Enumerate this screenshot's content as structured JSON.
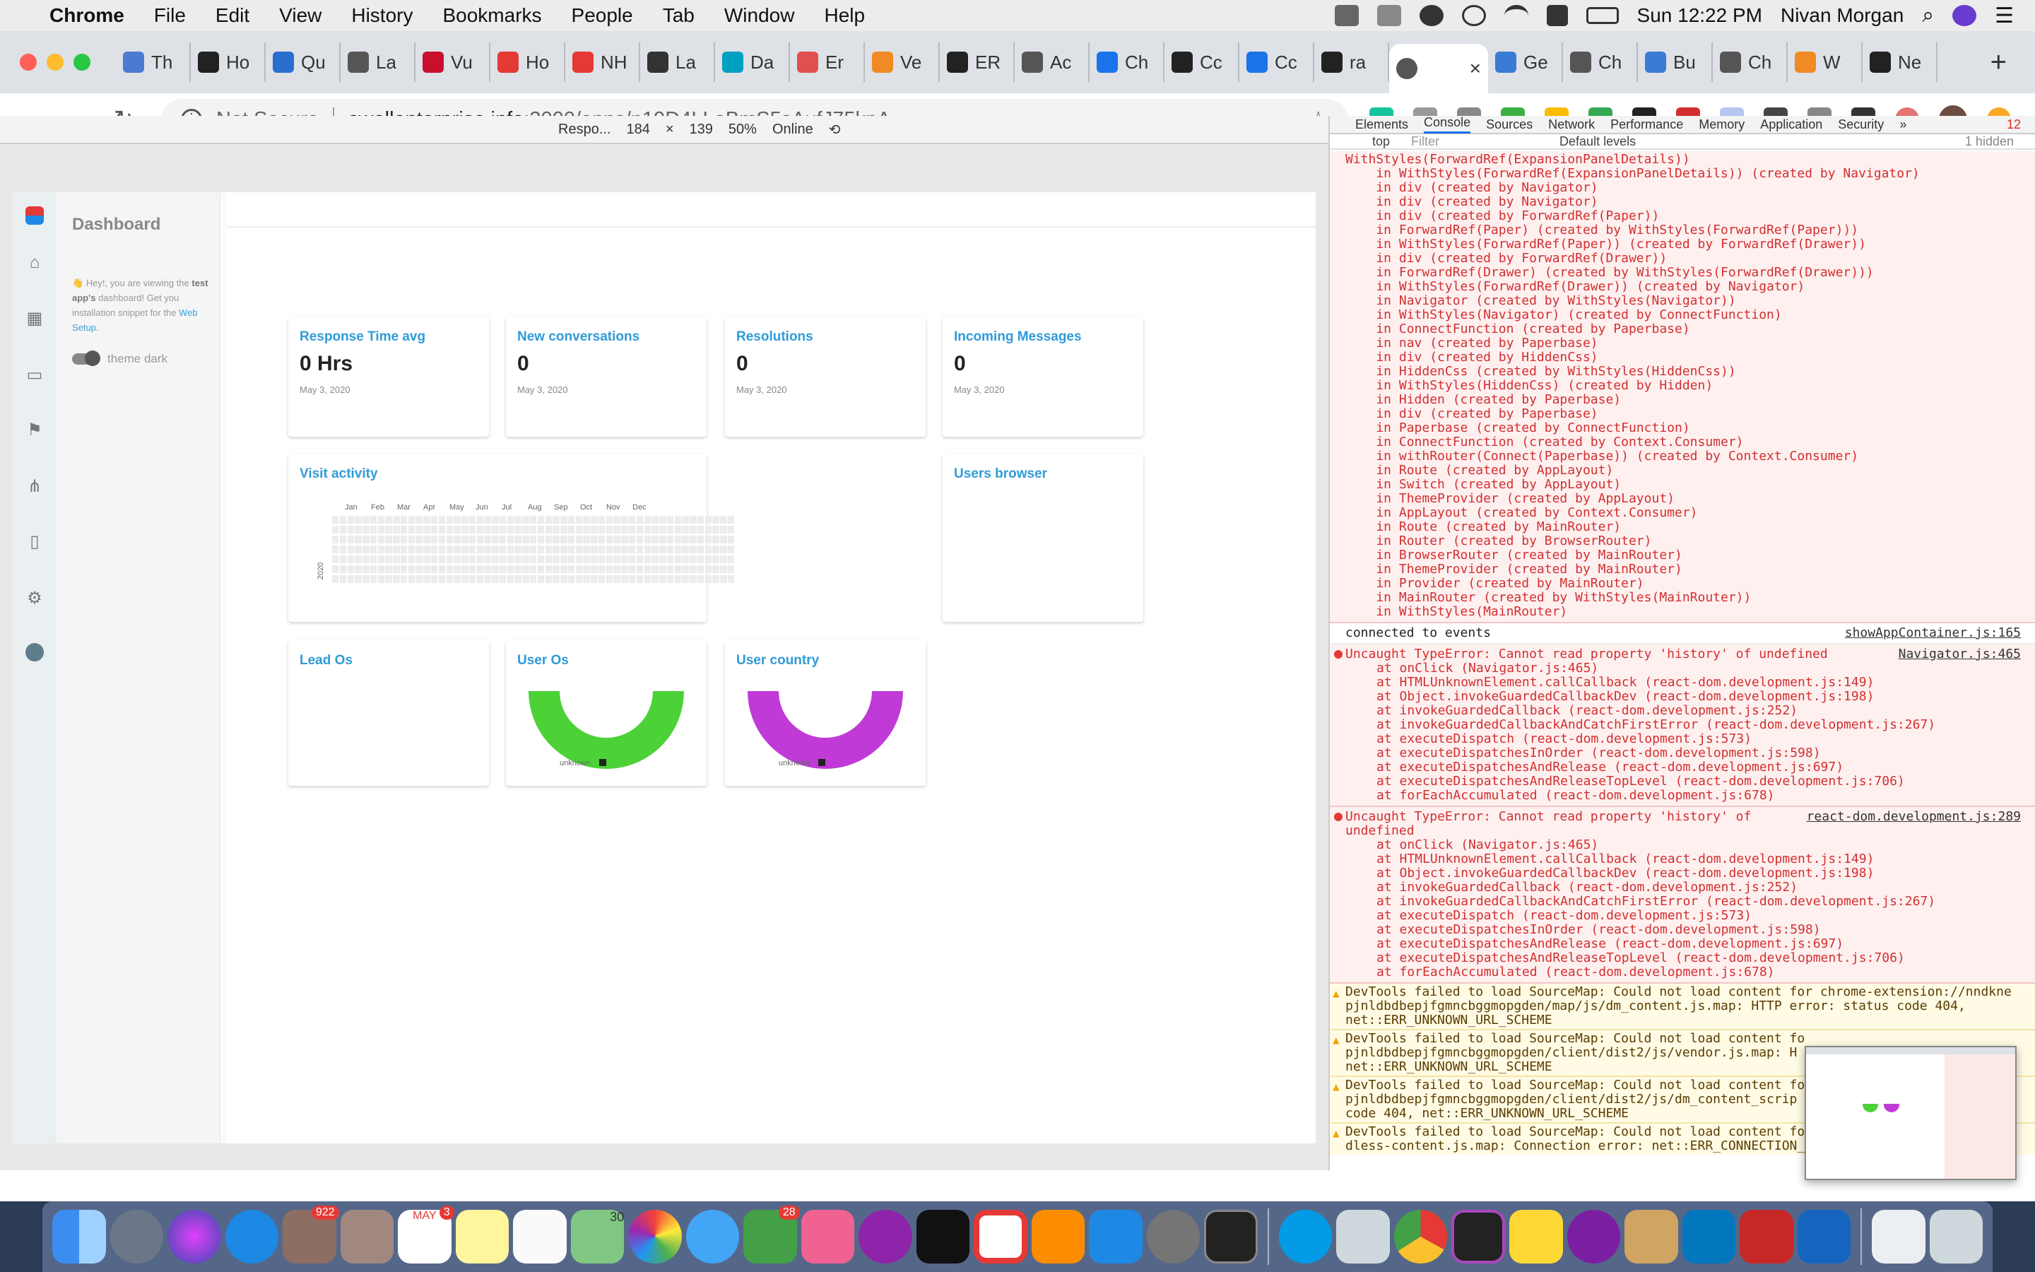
{
  "menubar": {
    "app": "Chrome",
    "items": [
      "File",
      "Edit",
      "View",
      "History",
      "Bookmarks",
      "People",
      "Tab",
      "Window",
      "Help"
    ],
    "clock": "Sun 12:22 PM",
    "user": "Nivan Morgan"
  },
  "tabs": [
    {
      "label": "Th",
      "color": "#4a7bd0"
    },
    {
      "label": "Ho",
      "color": "#222222"
    },
    {
      "label": "Qu",
      "color": "#2a6fd0"
    },
    {
      "label": "La",
      "color": "#555555"
    },
    {
      "label": "Vu",
      "color": "#c8102e"
    },
    {
      "label": "Ho",
      "color": "#e53935"
    },
    {
      "label": "NH",
      "color": "#e53935"
    },
    {
      "label": "La",
      "color": "#333333"
    },
    {
      "label": "Da",
      "color": "#00a0c0"
    },
    {
      "label": "Er",
      "color": "#e05050"
    },
    {
      "label": "Ve",
      "color": "#f08a24"
    },
    {
      "label": "ER",
      "color": "#222222"
    },
    {
      "label": "Ac",
      "color": "#555555"
    },
    {
      "label": "Ch",
      "color": "#1a73e8"
    },
    {
      "label": "Cc",
      "color": "#222222"
    },
    {
      "label": "Cc",
      "color": "#1a73e8"
    },
    {
      "label": "ra",
      "color": "#222222"
    }
  ],
  "active_tab": {
    "label": "",
    "close": "×"
  },
  "tabs_after": [
    {
      "label": "Ge",
      "color": "#3a7bd5"
    },
    {
      "label": "Ch",
      "color": "#555555"
    },
    {
      "label": "Bu",
      "color": "#3a7bd5"
    },
    {
      "label": "Ch",
      "color": "#555555"
    },
    {
      "label": "W",
      "color": "#f08a24"
    },
    {
      "label": "Ne",
      "color": "#222222"
    }
  ],
  "address": {
    "security": "Not Secure",
    "host": "swellenterprise.info",
    "path": ":3000/apps/p19D4LLoBmS5sAufJ75kpA"
  },
  "device_toolbar": {
    "device": "Respo...",
    "width": "184",
    "x": "×",
    "height": "139",
    "zoom": "50%",
    "network": "Online"
  },
  "app": {
    "drawer_title": "Dashboard",
    "hint_prefix": "Hey!, you are viewing the",
    "hint_app": "test app's",
    "hint_middle": "dashboard! Get you installation snippet for the",
    "hint_link": "Web Setup.",
    "theme_label": "theme dark",
    "stats": [
      {
        "title": "Response Time avg",
        "value": "0 Hrs",
        "date": "May 3, 2020"
      },
      {
        "title": "New conversations",
        "value": "0",
        "date": "May 3, 2020"
      },
      {
        "title": "Resolutions",
        "value": "0",
        "date": "May 3, 2020"
      },
      {
        "title": "Incoming Messages",
        "value": "0",
        "date": "May 3, 2020"
      }
    ],
    "visit_activity": {
      "title": "Visit activity",
      "year": "2020",
      "months": [
        "Jan",
        "Feb",
        "Mar",
        "Apr",
        "May",
        "Jun",
        "Jul",
        "Aug",
        "Sep",
        "Oct",
        "Nov",
        "Dec"
      ]
    },
    "users_browser": {
      "title": "Users browser"
    },
    "lead_os": {
      "title": "Lead Os"
    },
    "user_os": {
      "title": "User Os",
      "legend": "unknown",
      "color": "#4cd137"
    },
    "user_country": {
      "title": "User country",
      "legend": "unknown",
      "color": "#c03ad8"
    }
  },
  "devtools": {
    "tabs": [
      "Elements",
      "Console",
      "Sources",
      "Network",
      "Performance",
      "Memory",
      "Application",
      "Security"
    ],
    "active": "Console",
    "more": "»",
    "errors": "12",
    "context": "top",
    "filter_placeholder": "Filter",
    "levels": "Default levels",
    "hidden": "1 hidden",
    "stack_trace": "WithStyles(ForwardRef(ExpansionPanelDetails))\n    in WithStyles(ForwardRef(ExpansionPanelDetails)) (created by Navigator)\n    in div (created by Navigator)\n    in div (created by Navigator)\n    in div (created by ForwardRef(Paper))\n    in ForwardRef(Paper) (created by WithStyles(ForwardRef(Paper)))\n    in WithStyles(ForwardRef(Paper)) (created by ForwardRef(Drawer))\n    in div (created by ForwardRef(Drawer))\n    in ForwardRef(Drawer) (created by WithStyles(ForwardRef(Drawer)))\n    in WithStyles(ForwardRef(Drawer)) (created by Navigator)\n    in Navigator (created by WithStyles(Navigator))\n    in WithStyles(Navigator) (created by ConnectFunction)\n    in ConnectFunction (created by Paperbase)\n    in nav (created by Paperbase)\n    in div (created by HiddenCss)\n    in HiddenCss (created by WithStyles(HiddenCss))\n    in WithStyles(HiddenCss) (created by Hidden)\n    in Hidden (created by Paperbase)\n    in div (created by Paperbase)\n    in Paperbase (created by ConnectFunction)\n    in ConnectFunction (created by Context.Consumer)\n    in withRouter(Connect(Paperbase)) (created by Context.Consumer)\n    in Route (created by AppLayout)\n    in Switch (created by AppLayout)\n    in ThemeProvider (created by AppLayout)\n    in AppLayout (created by Context.Consumer)\n    in Route (created by MainRouter)\n    in Router (created by BrowserRouter)\n    in BrowserRouter (created by MainRouter)\n    in ThemeProvider (created by MainRouter)\n    in Provider (created by MainRouter)\n    in MainRouter (created by WithStyles(MainRouter))\n    in WithStyles(MainRouter)",
    "log1": {
      "text": "connected to events",
      "src": "showAppContainer.js:165"
    },
    "error1": {
      "msg": "Uncaught TypeError: Cannot read property 'history' of undefined",
      "src": "Navigator.js:465",
      "frames": "at onClick (Navigator.js:465)\nat HTMLUnknownElement.callCallback (react-dom.development.js:149)\nat Object.invokeGuardedCallbackDev (react-dom.development.js:198)\nat invokeGuardedCallback (react-dom.development.js:252)\nat invokeGuardedCallbackAndCatchFirstError (react-dom.development.js:267)\nat executeDispatch (react-dom.development.js:573)\nat executeDispatchesInOrder (react-dom.development.js:598)\nat executeDispatchesAndRelease (react-dom.development.js:697)\nat executeDispatchesAndReleaseTopLevel (react-dom.development.js:706)\nat forEachAccumulated (react-dom.development.js:678)"
    },
    "error2": {
      "msg": "Uncaught TypeError: Cannot read property 'history' of\nundefined",
      "src": "react-dom.development.js:289",
      "frames": "at onClick (Navigator.js:465)\nat HTMLUnknownElement.callCallback (react-dom.development.js:149)\nat Object.invokeGuardedCallbackDev (react-dom.development.js:198)\nat invokeGuardedCallback (react-dom.development.js:252)\nat invokeGuardedCallbackAndCatchFirstError (react-dom.development.js:267)\nat executeDispatch (react-dom.development.js:573)\nat executeDispatchesInOrder (react-dom.development.js:598)\nat executeDispatchesAndRelease (react-dom.development.js:697)\nat executeDispatchesAndReleaseTopLevel (react-dom.development.js:706)\nat forEachAccumulated (react-dom.development.js:678)"
    },
    "warnings": [
      "DevTools failed to load SourceMap: Could not load content for chrome-extension://nndkne\npjnldbdbepjfgmncbggmopgden/map/js/dm_content.js.map: HTTP error: status code 404,\nnet::ERR_UNKNOWN_URL_SCHEME",
      "DevTools failed to load SourceMap: Could not load content fo\npjnldbdbepjfgmncbggmopgden/client/dist2/js/vendor.js.map: H\nnet::ERR_UNKNOWN_URL_SCHEME",
      "DevTools failed to load SourceMap: Could not load content fo\npjnldbdbepjfgmncbggmopgden/client/dist2/js/dm_content_scrip\ncode 404, net::ERR_UNKNOWN_URL_SCHEME",
      "DevTools failed to load SourceMap: Could not load content fo\ndless-content.js.map: Connection error: net::ERR_CONNECTION_"
    ]
  },
  "dock": {
    "badges": {
      "mail": "922",
      "calendar": "3",
      "facetime": "28"
    },
    "calendar_month": "MAY",
    "maps_label": "30"
  }
}
